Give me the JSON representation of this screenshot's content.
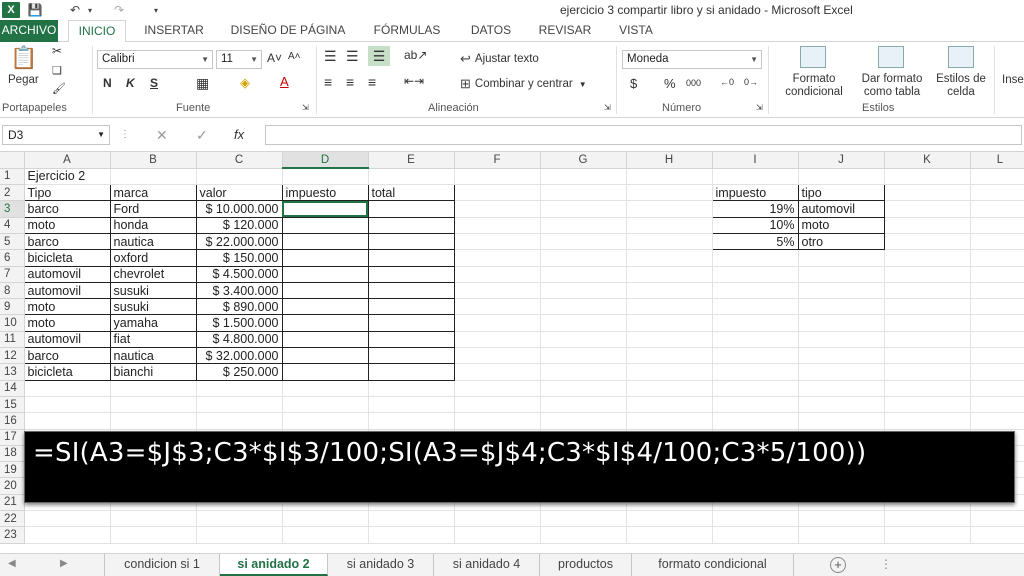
{
  "window": {
    "title": "ejercicio 3 compartir libro y si anidado - Microsoft Excel"
  },
  "ribbon_tabs": [
    "ARCHIVO",
    "INICIO",
    "INSERTAR",
    "DISEÑO DE PÁGINA",
    "FÓRMULAS",
    "DATOS",
    "REVISAR",
    "VISTA"
  ],
  "ribbon": {
    "paste_label": "Pegar",
    "clipboard_label": "Portapapeles",
    "font_name": "Calibri",
    "font_size": "11",
    "font_label": "Fuente",
    "wrap_text": "Ajustar texto",
    "merge_center": "Combinar y centrar",
    "alignment_label": "Alineación",
    "number_format": "Moneda",
    "number_label": "Número",
    "cond_format": [
      "Formato",
      "condicional"
    ],
    "format_table": [
      "Dar formato",
      "como tabla"
    ],
    "cell_styles": [
      "Estilos de",
      "celda"
    ],
    "styles_label": "Estilos",
    "insert_cut": "Inse",
    "bold": "N",
    "italic": "K",
    "underline": "S",
    "currency_symbol": "$",
    "percent_symbol": "%",
    "thousands": "000"
  },
  "formula_bar": {
    "name_box": "D3",
    "fx": "fx",
    "formula": ""
  },
  "columns": [
    "A",
    "B",
    "C",
    "D",
    "E",
    "F",
    "G",
    "H",
    "I",
    "J",
    "K",
    "L"
  ],
  "rows": [
    "1",
    "2",
    "3",
    "4",
    "5",
    "6",
    "7",
    "8",
    "9",
    "10",
    "11",
    "12",
    "13",
    "14",
    "15",
    "16",
    "17",
    "18",
    "19",
    "20",
    "21",
    "22",
    "23"
  ],
  "cells": {
    "title": "Ejercicio 2",
    "headers": [
      "Tipo",
      "marca",
      "valor",
      "impuesto",
      "total"
    ],
    "data": [
      [
        "barco",
        "Ford",
        "$ 10.000.000"
      ],
      [
        "moto",
        "honda",
        "$ 120.000"
      ],
      [
        "barco",
        "nautica",
        "$ 22.000.000"
      ],
      [
        "bicicleta",
        "oxford",
        "$ 150.000"
      ],
      [
        "automovil",
        "chevrolet",
        "$ 4.500.000"
      ],
      [
        "automovil",
        "susuki",
        "$ 3.400.000"
      ],
      [
        "moto",
        "susuki",
        "$ 890.000"
      ],
      [
        "moto",
        "yamaha",
        "$ 1.500.000"
      ],
      [
        "automovil",
        "fiat",
        "$ 4.800.000"
      ],
      [
        "barco",
        "nautica",
        "$ 32.000.000"
      ],
      [
        "bicicleta",
        "bianchi",
        "$ 250.000"
      ]
    ],
    "tax_headers": [
      "impuesto",
      "tipo"
    ],
    "tax_table": [
      [
        "19%",
        "automovil"
      ],
      [
        "10%",
        "moto"
      ],
      [
        "5%",
        "otro"
      ]
    ]
  },
  "overlay_formula": "=SI(A3=$J$3;C3*$I$3/100;SI(A3=$J$4;C3*$I$4/100;C3*5/100))",
  "sheet_tabs": [
    "condicion si 1",
    "si anidado 2",
    "si anidado 3",
    "si anidado 4",
    "productos",
    "formato condicional"
  ],
  "active_sheet": "si anidado 2",
  "colors": {
    "accent": "#217346"
  }
}
